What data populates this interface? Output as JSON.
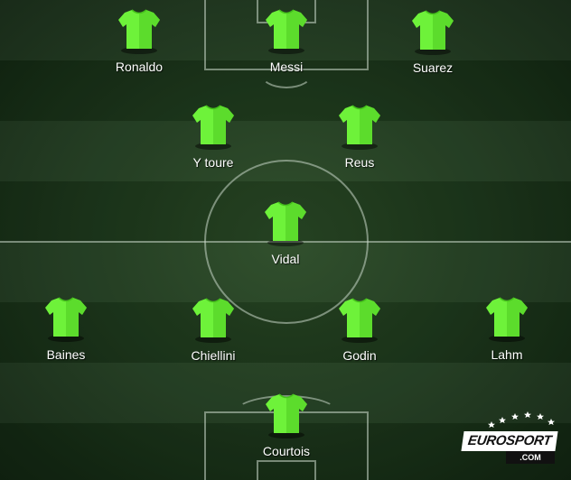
{
  "formation": {
    "players": [
      {
        "id": "ronaldo",
        "name": "Ronaldo"
      },
      {
        "id": "messi",
        "name": "Messi"
      },
      {
        "id": "suarez",
        "name": "Suarez"
      },
      {
        "id": "ytoure",
        "name": "Y toure"
      },
      {
        "id": "reus",
        "name": "Reus"
      },
      {
        "id": "vidal",
        "name": "Vidal"
      },
      {
        "id": "baines",
        "name": "Baines"
      },
      {
        "id": "chiellini",
        "name": "Chiellini"
      },
      {
        "id": "godin",
        "name": "Godin"
      },
      {
        "id": "lahm",
        "name": "Lahm"
      },
      {
        "id": "courtois",
        "name": "Courtois"
      }
    ]
  },
  "colors": {
    "shirt": "#6ef23a",
    "shirt_shade": "#46c21c",
    "pitch": "#1c361b",
    "line": "#c8d7c8"
  },
  "branding": {
    "logo_main": "EUROSPORT",
    "logo_sub": ".COM"
  }
}
